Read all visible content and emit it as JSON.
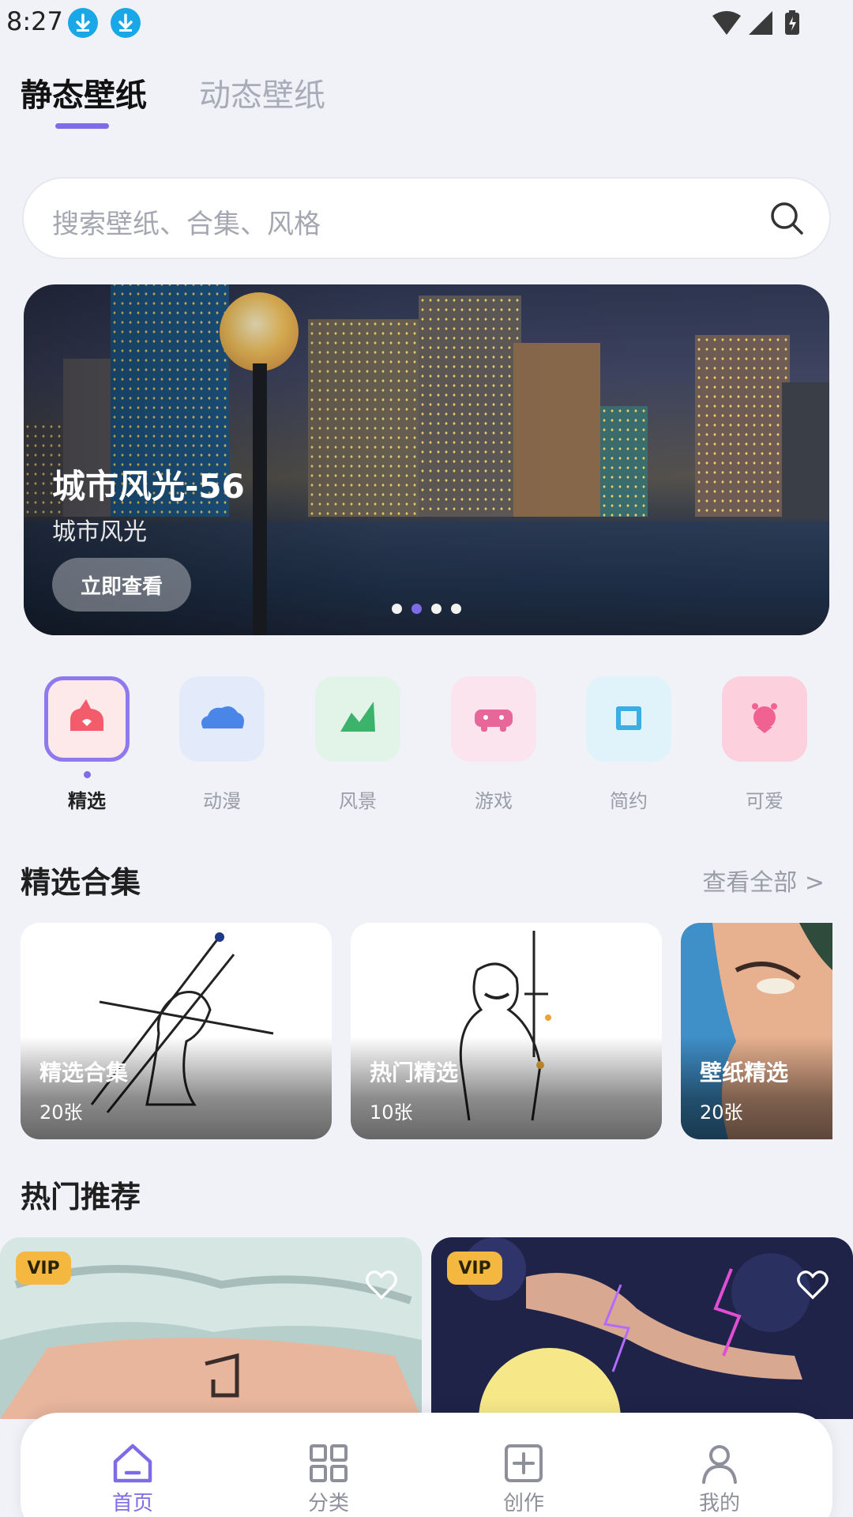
{
  "status_bar": {
    "time": "8:27"
  },
  "tabs": [
    {
      "label": "静态壁纸",
      "active": true
    },
    {
      "label": "动态壁纸",
      "active": false
    }
  ],
  "search": {
    "placeholder": "搜索壁纸、合集、风格"
  },
  "banner": {
    "title": "城市风光-56",
    "subtitle": "城市风光",
    "button": "立即查看",
    "page_count": 4,
    "active_page": 2
  },
  "categories": [
    {
      "label": "精选",
      "icon": "featured-icon",
      "color": "#f25c6b",
      "active": true
    },
    {
      "label": "动漫",
      "icon": "cloud-icon",
      "color": "#4a86e8",
      "active": false
    },
    {
      "label": "风景",
      "icon": "mountain-icon",
      "color": "#3bb36a",
      "active": false
    },
    {
      "label": "游戏",
      "icon": "gamepad-icon",
      "color": "#e8679a",
      "active": false
    },
    {
      "label": "简约",
      "icon": "square-icon",
      "color": "#3aaee0",
      "active": false
    },
    {
      "label": "可爱",
      "icon": "cute-icon",
      "color": "#f06292",
      "active": false
    }
  ],
  "collections": {
    "title": "精选合集",
    "see_all": "查看全部 >",
    "items": [
      {
        "title": "精选合集",
        "count": "20张"
      },
      {
        "title": "热门精选",
        "count": "10张"
      },
      {
        "title": "壁纸精选",
        "count": "20张"
      }
    ]
  },
  "hot": {
    "title": "热门推荐",
    "items": [
      {
        "badge": "VIP"
      },
      {
        "badge": "VIP"
      }
    ]
  },
  "bottom_nav": [
    {
      "label": "首页",
      "icon": "home-icon",
      "active": true
    },
    {
      "label": "分类",
      "icon": "grid-icon",
      "active": false
    },
    {
      "label": "创作",
      "icon": "plus-square-icon",
      "active": false
    },
    {
      "label": "我的",
      "icon": "user-icon",
      "active": false
    }
  ],
  "colors": {
    "accent": "#7d6ce6",
    "vip": "#f4b740",
    "background": "#f1f2f8"
  }
}
